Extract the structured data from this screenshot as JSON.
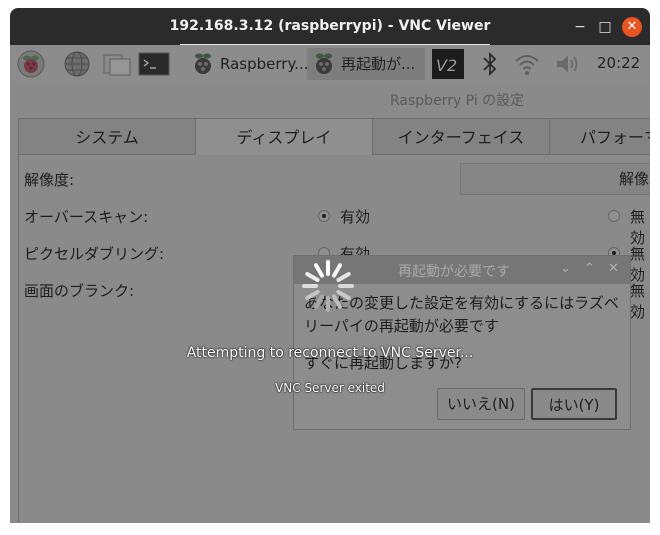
{
  "window": {
    "title": "192.168.3.12 (raspberrypi) - VNC Viewer",
    "minimize": "−",
    "maximize": "□",
    "close": "✕"
  },
  "taskbar": {
    "tasks": [
      {
        "label": "Raspberry..."
      },
      {
        "label": "再起動が..."
      }
    ],
    "clock": "20:22"
  },
  "settings": {
    "title": "Raspberry Pi の設定",
    "tabs": [
      "システム",
      "ディスプレイ",
      "インターフェイス",
      "パフォーマ"
    ],
    "active_tab": 1,
    "rows": {
      "resolution": {
        "label": "解像度:",
        "button": "解像"
      },
      "overscan": {
        "label": "オーバースキャン:",
        "enabled": "有効",
        "disabled": "無効"
      },
      "pixel_doubling": {
        "label": "ピクセルダブリング:",
        "enabled": "有効",
        "disabled": "無効"
      },
      "screen_blank": {
        "label": "画面のブランク:",
        "disabled": "無効"
      }
    }
  },
  "dialog": {
    "title": "再起動が必要です",
    "message": "あなたの変更した設定を有効にするにはラズベリーパイの再起動が必要です",
    "question": "すぐに再起動しますか?",
    "no_button": "いいえ(N)",
    "yes_button": "はい(Y)"
  },
  "overlay": {
    "status": "Attempting to reconnect to VNC Server...",
    "detail": "VNC Server exited"
  },
  "colors": {
    "titlebar": "#2b2b2b",
    "close_button": "#e95420",
    "dimmed_desktop": "#8a8a8a"
  }
}
